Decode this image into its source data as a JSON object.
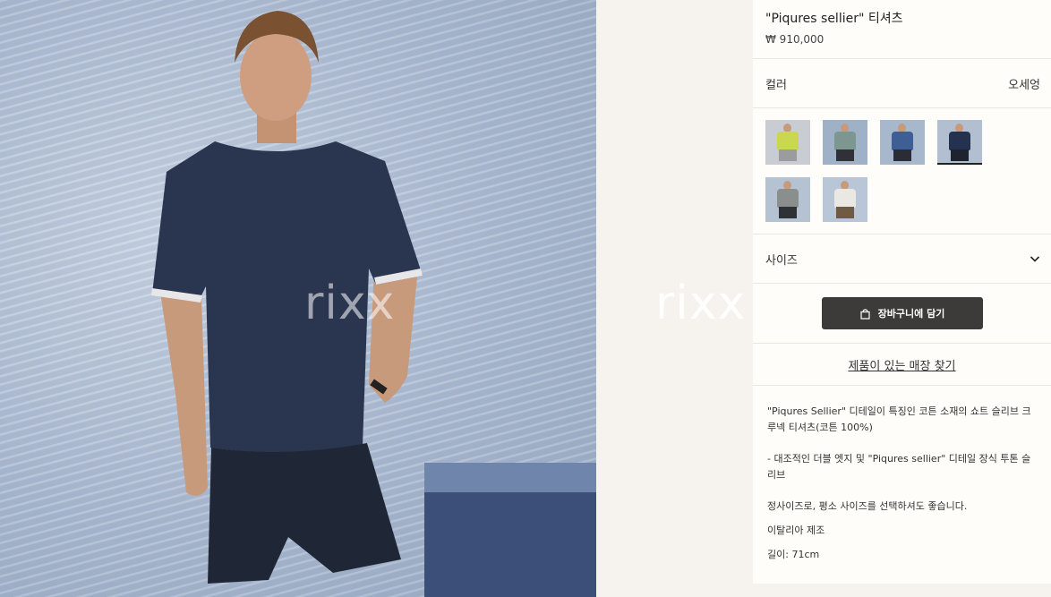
{
  "product": {
    "title": "\"Piqures sellier\" 티셔츠",
    "price": "₩ 910,000"
  },
  "watermark": "rixx",
  "color": {
    "label": "컬러",
    "value": "오세엉",
    "swatches": [
      {
        "name": "lime",
        "shirt": "#c9d850",
        "bg": "#c9cdd3",
        "shorts": "#9a9c9e"
      },
      {
        "name": "sage",
        "shirt": "#7d9690",
        "bg": "#9fb1c6",
        "shorts": "#2f3136"
      },
      {
        "name": "blue",
        "shirt": "#3e5f96",
        "bg": "#a7b7cc",
        "shorts": "#2a2d35"
      },
      {
        "name": "navy",
        "shirt": "#243250",
        "bg": "#b1bfd1",
        "shorts": "#1e2330"
      },
      {
        "name": "grey",
        "shirt": "#8a8e8c",
        "bg": "#b5c2d2",
        "shorts": "#2e3136"
      },
      {
        "name": "white",
        "shirt": "#e9e8e3",
        "bg": "#b8c6d8",
        "shorts": "#6f5a44"
      }
    ]
  },
  "size": {
    "label": "사이즈"
  },
  "cart": {
    "label": "장바구니에 담기"
  },
  "store_link": "제품이 있는 매장 찾기",
  "description": {
    "p1": "\"Piqures Sellier\" 디테일이 특징인 코튼 소재의 쇼트 슬리브 크루넥 티셔츠(코튼 100%)",
    "p2": "- 대조적인 더블 엣지 및 \"Piqures sellier\" 디테일 장식 투톤 슬리브",
    "p3": "정사이즈로, 평소 사이즈를 선택하셔도 좋습니다.",
    "p4": "이탈리아 제조",
    "p5": "길이: 71cm"
  },
  "colors": {
    "button": "#3c3b39",
    "panel_bg": "#fffdf9",
    "page_bg": "#f6f3ee"
  }
}
